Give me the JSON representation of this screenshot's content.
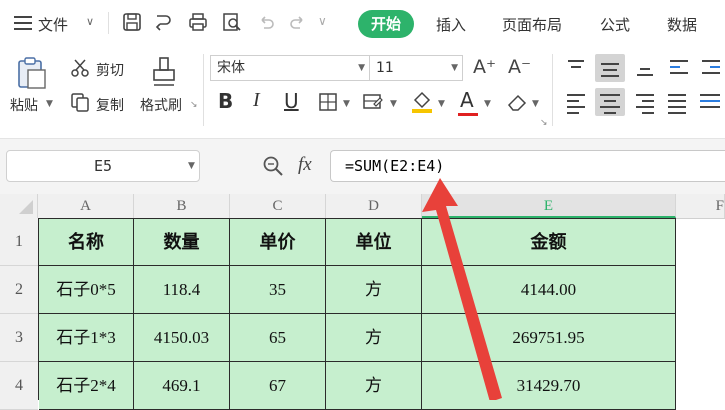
{
  "menubar": {
    "file_label": "文件",
    "tabs": [
      "开始",
      "插入",
      "页面布局",
      "公式",
      "数据"
    ]
  },
  "ribbon": {
    "paste_label": "粘贴",
    "cut_label": "剪切",
    "copy_label": "复制",
    "format_painter_label": "格式刷",
    "font_name": "宋体",
    "font_size": "11",
    "bold": "B",
    "italic": "I",
    "underline": "U",
    "grow_font": "A⁺",
    "shrink_font": "A⁻",
    "font_color_glyph": "A"
  },
  "formula": {
    "name_box": "E5",
    "fx_glyph": "fx",
    "value": "=SUM(E2:E4)"
  },
  "sheet": {
    "columns": [
      "A",
      "B",
      "C",
      "D",
      "E",
      "F"
    ],
    "rows": [
      "1",
      "2",
      "3",
      "4"
    ],
    "header": [
      "名称",
      "数量",
      "单价",
      "单位",
      "金额"
    ],
    "data": [
      [
        "石子0*5",
        "118.4",
        "35",
        "方",
        "4144.00"
      ],
      [
        "石子1*3",
        "4150.03",
        "65",
        "方",
        "269751.95"
      ],
      [
        "石子2*4",
        "469.1",
        "67",
        "方",
        "31429.70"
      ]
    ]
  },
  "colors": {
    "accent": "#2db36b",
    "cell_fill": "#c6efce",
    "arrow": "#e8413a"
  }
}
